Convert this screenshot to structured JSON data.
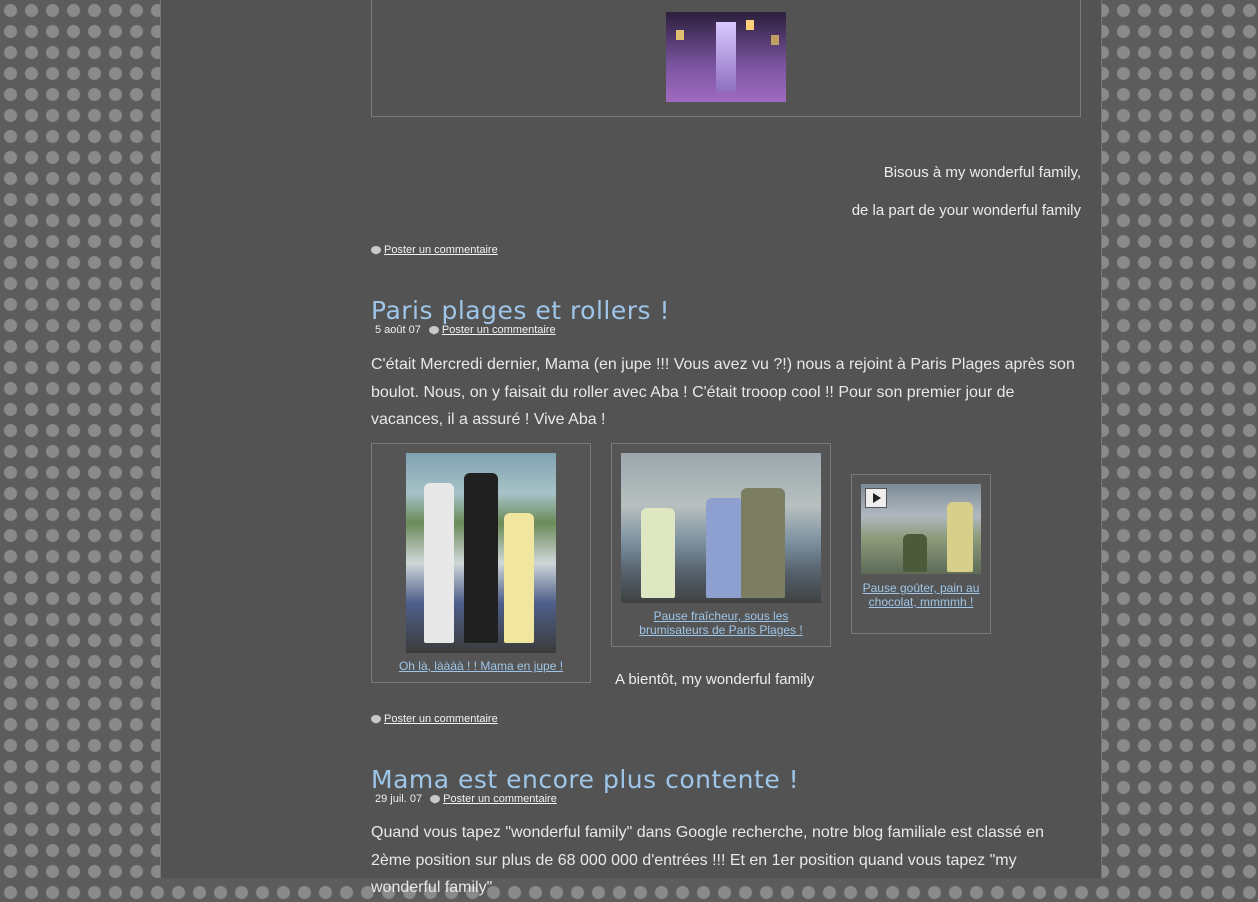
{
  "post_top": {
    "signoff_line1": "Bisous à my wonderful family,",
    "signoff_line2": "de la part de your wonderful family",
    "comment_label": "Poster un commentaire"
  },
  "post_paris": {
    "title": "Paris plages et rollers !",
    "date": "5 août 07",
    "comment_label": "Poster un commentaire",
    "body": "C'était Mercredi dernier, Mama (en jupe !!! Vous avez vu ?!) nous a rejoint à Paris Plages après son boulot. Nous, on y faisait du roller avec Aba ! C'était trooop cool !! Pour son premier jour de vacances, il a assuré ! Vive Aba !",
    "photos": [
      {
        "caption": "Oh là, làààà ! ! Mama en jupe !"
      },
      {
        "caption": "Pause fraîcheur, sous les brumisateurs de Paris Plages !"
      },
      {
        "caption": "Pause goûter, pain au chocolat, mmmmh !"
      }
    ],
    "closing": "A bientôt, my wonderful family",
    "footer_comment_label": "Poster un commentaire"
  },
  "post_mama": {
    "title": "Mama est encore plus contente !",
    "date": "29 juil. 07",
    "comment_label": "Poster un commentaire",
    "body": "Quand vous tapez \"wonderful family\" dans Google recherche, notre blog familiale est classé en 2ème position sur plus de 68 000 000 d'entrées !!! Et en 1er position quand vous tapez \"my wonderful family\""
  }
}
